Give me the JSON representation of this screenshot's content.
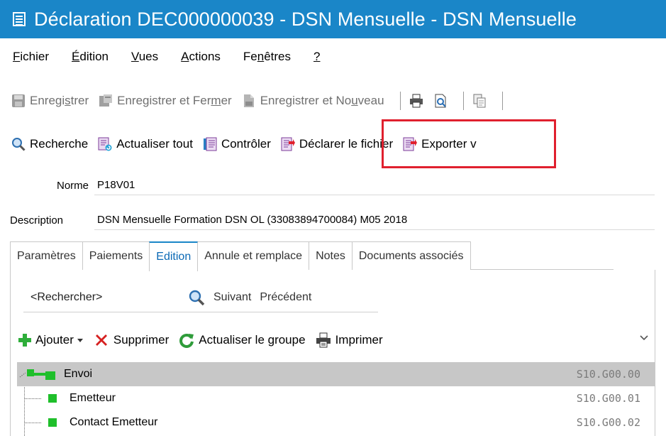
{
  "window": {
    "title": "Déclaration DEC000000039  - DSN Mensuelle - DSN Mensuelle"
  },
  "menu": [
    {
      "label": "Fichier",
      "accel": "F",
      "rest": "ichier"
    },
    {
      "label": "Édition",
      "accel": "É",
      "rest": "dition"
    },
    {
      "label": "Vues",
      "accel": "V",
      "rest": "ues"
    },
    {
      "label": "Actions",
      "accel": "A",
      "rest": "ctions"
    },
    {
      "label": "Fenêtres",
      "pre": "Fe",
      "accel": "n",
      "rest": "êtres"
    },
    {
      "label": "?",
      "accel": "?",
      "rest": ""
    }
  ],
  "toolbar1": {
    "save": {
      "pre": "Enregi",
      "accel": "s",
      "rest": "trer"
    },
    "save_close": {
      "pre": "Enregistrer et Fer",
      "accel": "m",
      "rest": "er"
    },
    "save_new": {
      "pre": "Enregistrer et No",
      "accel": "u",
      "rest": "veau"
    }
  },
  "toolbar2": {
    "search": "Recherche",
    "refresh_all": "Actualiser tout",
    "control": "Contrôler",
    "declare": "Déclarer le fichier",
    "export": "Exporter v"
  },
  "fields": {
    "norme_label": "Norme",
    "norme_value": "P18V01",
    "description_label": "Description",
    "description_value": "DSN Mensuelle Formation DSN OL (33083894700084) M05 2018"
  },
  "tabs": [
    "Paramètres",
    "Paiements",
    "Edition",
    "Annule et remplace",
    "Notes",
    "Documents associés"
  ],
  "active_tab": "Edition",
  "search": {
    "placeholder": "<Rechercher>",
    "next": "Suivant",
    "previous": "Précédent"
  },
  "actions": {
    "add": "Ajouter",
    "delete": "Supprimer",
    "refresh_group": "Actualiser le groupe",
    "print": "Imprimer"
  },
  "tree": [
    {
      "label": "Envoi",
      "code": "S10.G00.00",
      "selected": true
    },
    {
      "label": "Emetteur",
      "code": "S10.G00.01"
    },
    {
      "label": "Contact Emetteur",
      "code": "S10.G00.02"
    }
  ],
  "colors": {
    "titlebar": "#1a86c8",
    "highlight_box": "#e0202e",
    "tree_node": "#1fbf2b",
    "active_tab": "#0a69b5"
  }
}
